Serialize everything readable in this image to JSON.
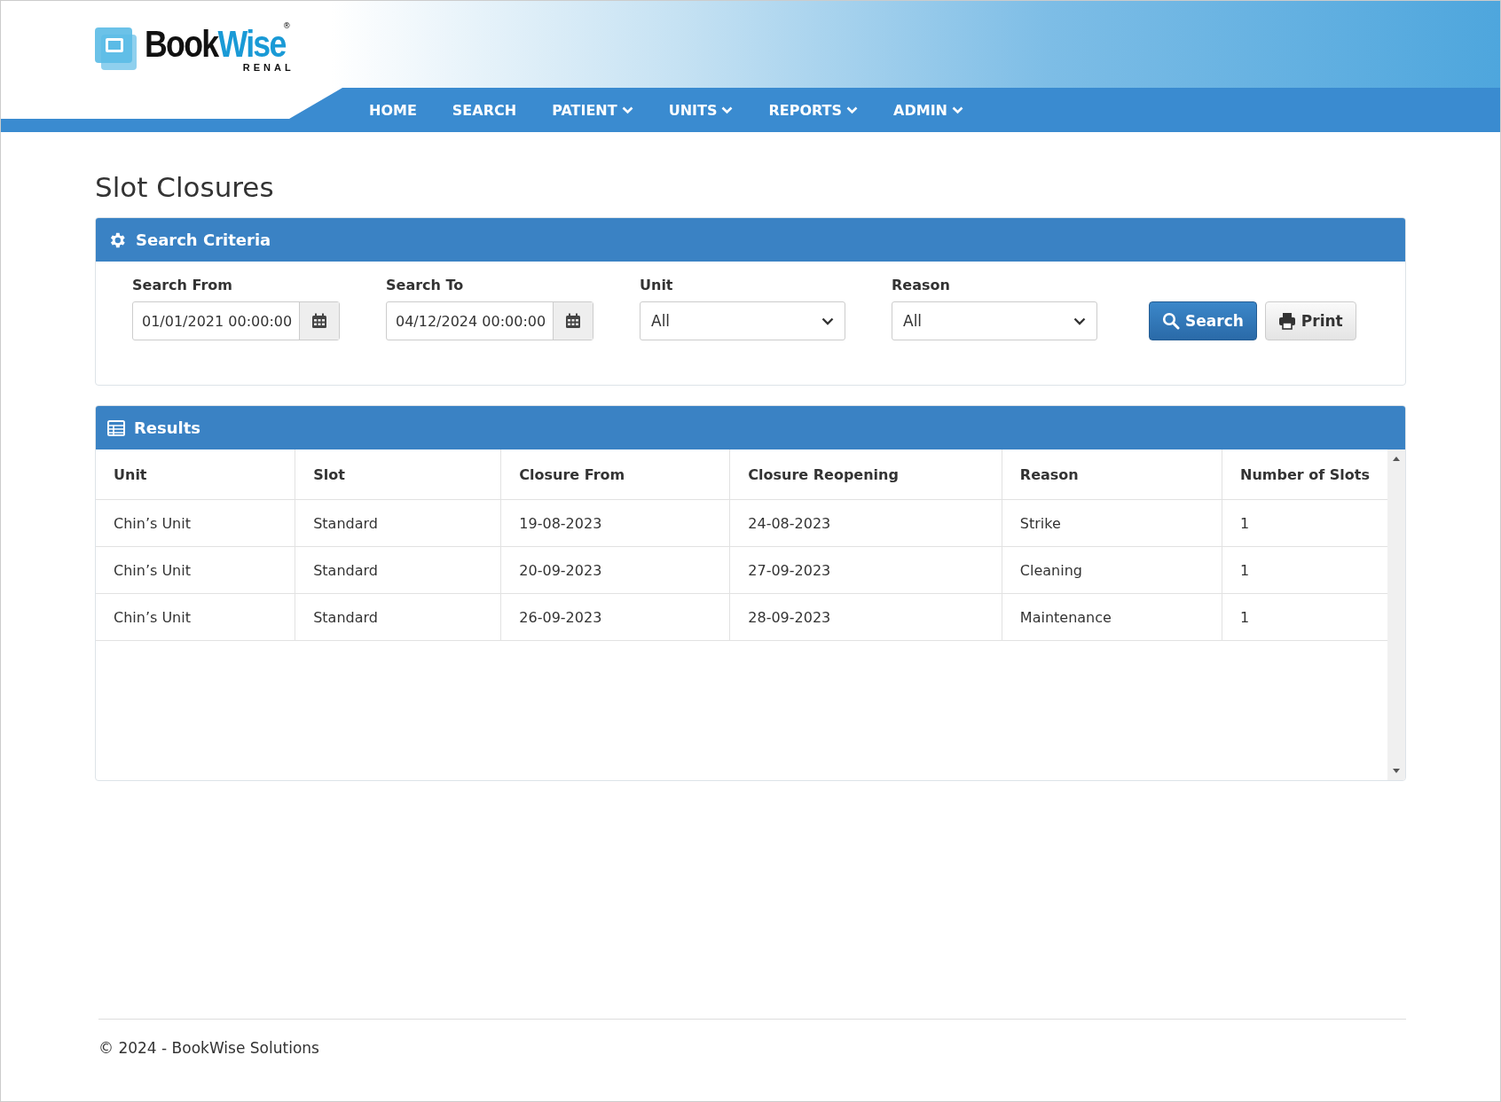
{
  "logo": {
    "name_a": "Book",
    "name_b": "Wise",
    "registered": "®",
    "subtitle": "RENAL"
  },
  "nav": [
    {
      "label": "HOME",
      "dropdown": false
    },
    {
      "label": "SEARCH",
      "dropdown": false
    },
    {
      "label": "PATIENT",
      "dropdown": true
    },
    {
      "label": "UNITS",
      "dropdown": true
    },
    {
      "label": "REPORTS",
      "dropdown": true
    },
    {
      "label": "ADMIN",
      "dropdown": true
    }
  ],
  "page_title": "Slot Closures",
  "search_panel": {
    "title": "Search Criteria",
    "fields": [
      {
        "kind": "date",
        "label": "Search From",
        "value": "01/01/2021 00:00:00"
      },
      {
        "kind": "date",
        "label": "Search To",
        "value": "04/12/2024 00:00:00"
      },
      {
        "kind": "select",
        "label": "Unit",
        "value": "All"
      },
      {
        "kind": "select",
        "label": "Reason",
        "value": "All"
      }
    ],
    "buttons": [
      {
        "kind": "primary",
        "label": "Search"
      },
      {
        "kind": "print",
        "label": "Print"
      }
    ]
  },
  "results_panel": {
    "title": "Results",
    "columns": [
      "Unit",
      "Slot",
      "Closure From",
      "Closure Reopening",
      "Reason",
      "Number of Slots"
    ],
    "rows": [
      [
        "Chin’s Unit",
        "Standard",
        "19-08-2023",
        "24-08-2023",
        "Strike",
        "1"
      ],
      [
        "Chin’s Unit",
        "Standard",
        "20-09-2023",
        "27-09-2023",
        "Cleaning",
        "1"
      ],
      [
        "Chin’s Unit",
        "Standard",
        "26-09-2023",
        "28-09-2023",
        "Maintenance",
        "1"
      ]
    ]
  },
  "footer": "© 2024  - BookWise Solutions"
}
